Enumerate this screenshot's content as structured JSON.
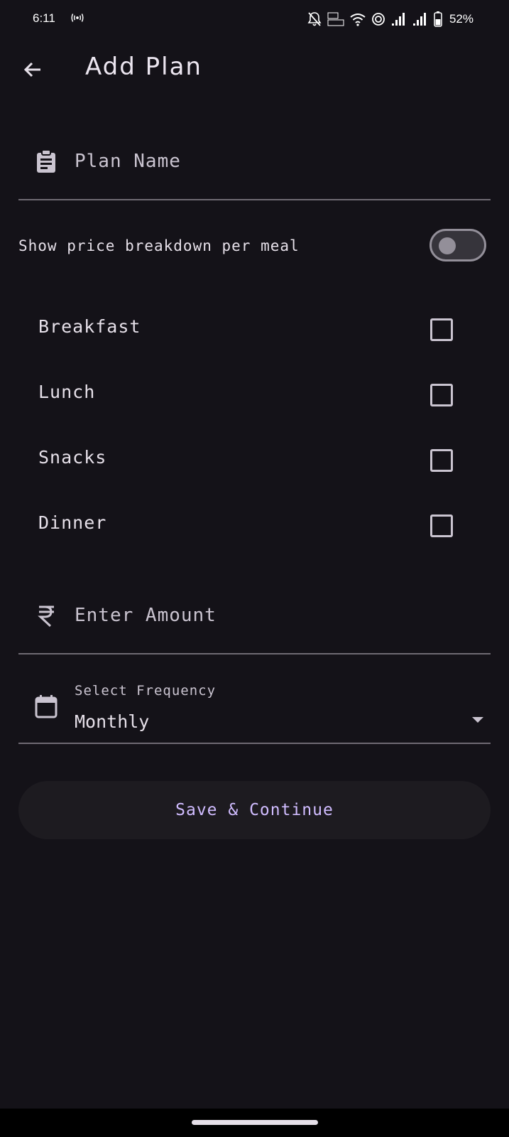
{
  "status_bar": {
    "time": "6:11",
    "battery": "52%"
  },
  "app_bar": {
    "title": "Add Plan"
  },
  "plan_name": {
    "placeholder": "Plan Name"
  },
  "toggle": {
    "label": "Show price breakdown per meal",
    "checked": false
  },
  "meals": [
    {
      "label": "Breakfast",
      "checked": false
    },
    {
      "label": "Lunch",
      "checked": false
    },
    {
      "label": "Snacks",
      "checked": false
    },
    {
      "label": "Dinner",
      "checked": false
    }
  ],
  "amount": {
    "placeholder": "Enter Amount"
  },
  "frequency": {
    "label": "Select Frequency",
    "value": "Monthly"
  },
  "save_button": {
    "label": "Save & Continue"
  },
  "colors": {
    "background": "#141218",
    "accent": "#d0bcff",
    "button_bg": "#1d1b20"
  },
  "icons": {
    "back": "arrow-left-icon",
    "plan_name": "clipboard-icon",
    "amount": "rupee-icon",
    "frequency": "calendar-icon",
    "dropdown": "dropdown-arrow-icon"
  }
}
